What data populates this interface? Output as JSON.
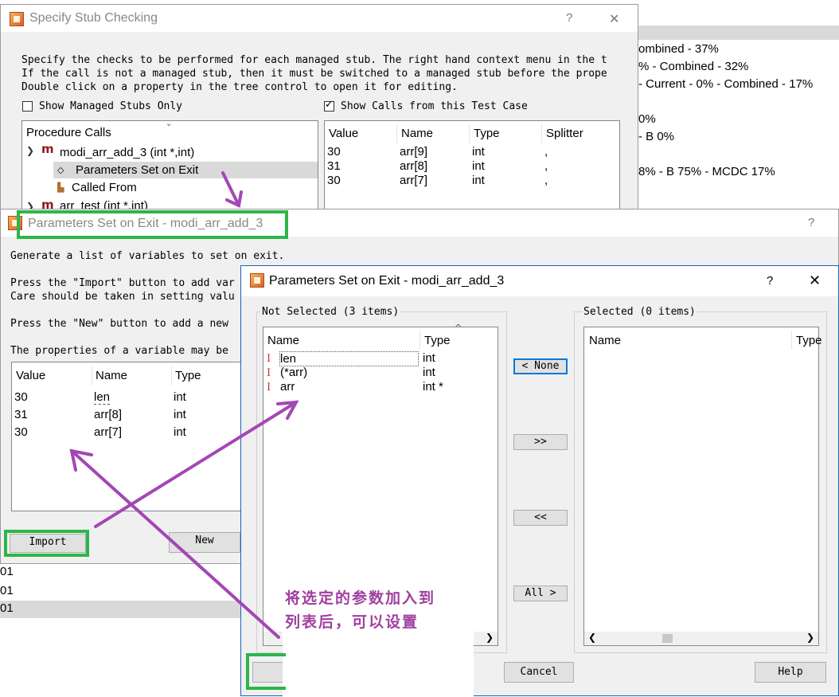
{
  "background": {
    "right_lines": [
      "ombined - 37%",
      "% - Combined - 32%",
      "- Current - 0% - Combined - 17%",
      "0%",
      "- B 0%",
      "8% - B 75% - MCDC 17%"
    ],
    "left_rows": [
      "01",
      "01",
      "01"
    ]
  },
  "stub_dialog": {
    "title": "Specify Stub Checking",
    "help": "?",
    "close": "✕",
    "instructions": [
      "Specify the checks to be performed for each managed stub. The right hand context menu in the t",
      "If the call is not a managed stub, then it must be switched to a managed stub before the prope",
      "Double click on a property in the tree control to open it for editing."
    ],
    "show_managed_label": "Show Managed Stubs Only",
    "show_calls_label": "Show Calls from this Test Case",
    "tree": {
      "header": "Procedure Calls",
      "nodes": [
        {
          "label": "modi_arr_add_3 (int *,int)"
        },
        {
          "label": "Parameters Set on Exit"
        },
        {
          "label": "Called From"
        },
        {
          "label": "arr_test (int *,int)"
        }
      ]
    },
    "table": {
      "headers": [
        "Value",
        "Name",
        "Type",
        "Splitter"
      ],
      "rows": [
        {
          "value": "30",
          "name": "arr[9]",
          "type": "int",
          "splitter": ","
        },
        {
          "value": "31",
          "name": "arr[8]",
          "type": "int",
          "splitter": ","
        },
        {
          "value": "30",
          "name": "arr[7]",
          "type": "int",
          "splitter": ","
        }
      ]
    }
  },
  "exit_dialog": {
    "title": "Parameters Set on Exit - modi_arr_add_3",
    "help": "?",
    "line1": "Generate a list of variables to set on exit.",
    "line2": "Press the \"Import\" button to add var",
    "line3": "Care should be taken in setting valu",
    "line4": "Press the \"New\" button to add a new",
    "line5": "The properties of a variable may be",
    "table": {
      "headers": [
        "Value",
        "Name",
        "Type"
      ],
      "rows": [
        {
          "value": "30",
          "name": "len",
          "type": "int"
        },
        {
          "value": "31",
          "name": "arr[8]",
          "type": "int"
        },
        {
          "value": "30",
          "name": "arr[7]",
          "type": "int"
        }
      ]
    },
    "import_label": "Import",
    "new_label": "New"
  },
  "select_dialog": {
    "title": "Parameters Set on Exit - modi_arr_add_3",
    "help": "?",
    "close": "✕",
    "not_selected_label": "Not Selected (3 items)",
    "selected_label": "Selected (0 items)",
    "left_headers": [
      "Name",
      "Type"
    ],
    "right_headers": [
      "Name",
      "Type"
    ],
    "items": [
      {
        "marker": "I",
        "name": "len",
        "type": "int"
      },
      {
        "marker": "I",
        "name": "(*arr)",
        "type": "int"
      },
      {
        "marker": "I",
        "name": "arr",
        "type": "int *"
      }
    ],
    "btn_none": "< None",
    "btn_add": ">>",
    "btn_remove": "<<",
    "btn_all": "All >",
    "cancel_label": "Cancel",
    "help_label": "Help",
    "ok_partial": "("
  },
  "annotation": {
    "lines": [
      "将选定的参数加入到",
      "列表后，可以设置"
    ],
    "color": "#a040a0"
  },
  "colors": {
    "highlight_green": "#2db54a",
    "arrow_purple": "#a347b5",
    "selection_blue": "#0078d7"
  }
}
